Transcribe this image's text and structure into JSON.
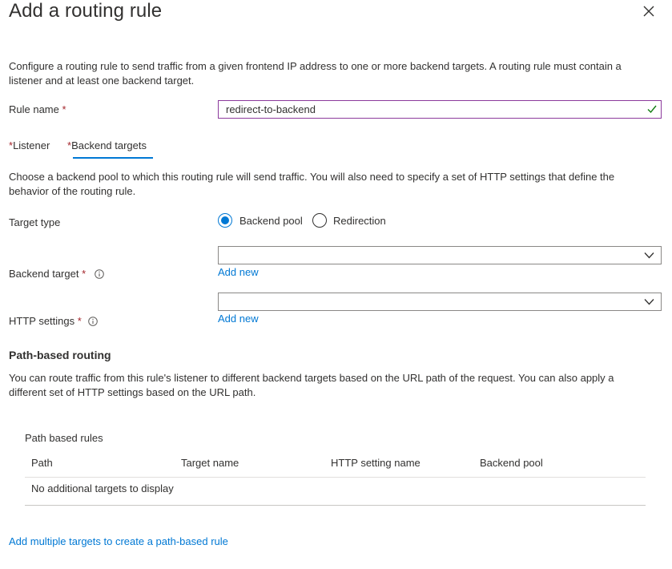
{
  "panel": {
    "title": "Add a routing rule",
    "description": "Configure a routing rule to send traffic from a given frontend IP address to one or more backend targets. A routing rule must contain a listener and at least one backend target."
  },
  "rule_name": {
    "label": "Rule name",
    "required_mark": "*",
    "value": "redirect-to-backend"
  },
  "tabs": [
    {
      "label": "Listener",
      "required_mark": "*"
    },
    {
      "label": "Backend targets",
      "required_mark": "*",
      "selected": true
    }
  ],
  "backend_targets": {
    "description": "Choose a backend pool to which this routing rule will send traffic. You will also need to specify a set of HTTP settings that define the behavior of the routing rule.",
    "target_type": {
      "label": "Target type",
      "options": [
        {
          "label": "Backend pool",
          "checked": true
        },
        {
          "label": "Redirection",
          "checked": false
        }
      ]
    },
    "backend_target": {
      "label": "Backend target",
      "required_mark": "*",
      "value": "",
      "add_new": "Add new"
    },
    "http_settings": {
      "label": "HTTP settings",
      "required_mark": "*",
      "value": "",
      "add_new": "Add new"
    }
  },
  "path_routing": {
    "heading": "Path-based routing",
    "description": "You can route traffic from this rule's listener to different backend targets based on the URL path of the request. You can also apply a different set of HTTP settings based on the URL path.",
    "table_title": "Path based rules",
    "columns": [
      "Path",
      "Target name",
      "HTTP setting name",
      "Backend pool"
    ],
    "empty_text": "No additional targets to display",
    "add_link": "Add multiple targets to create a path-based rule"
  },
  "colors": {
    "accent": "#0078d4",
    "required": "#a4262c",
    "valid": "#107c10",
    "focus_border": "#8c3a9c"
  },
  "icons": [
    "close-icon",
    "checkmark-icon",
    "chevron-down-icon",
    "info-icon"
  ]
}
